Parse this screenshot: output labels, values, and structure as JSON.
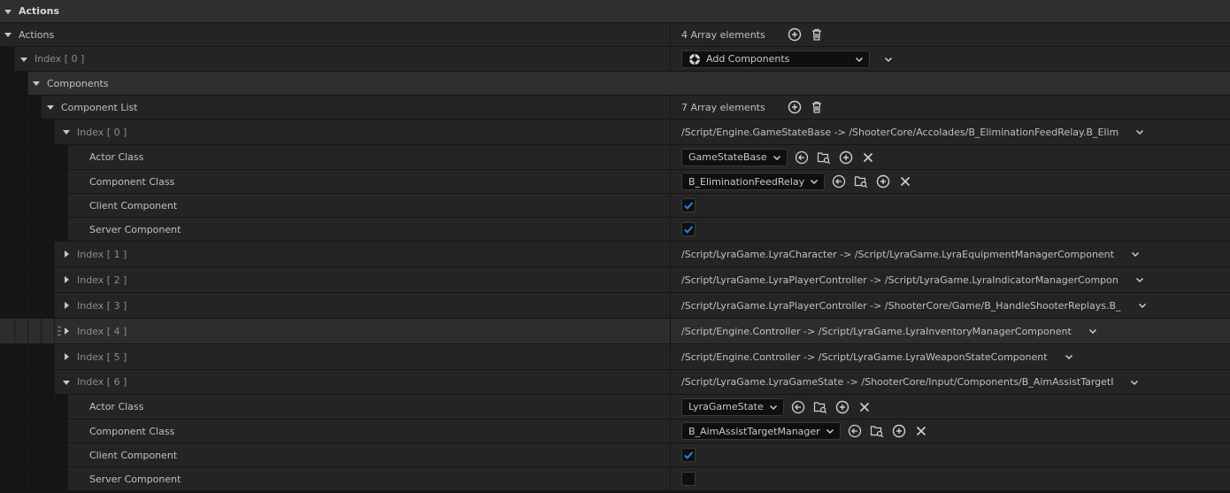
{
  "section": {
    "title": "Actions"
  },
  "rows": {
    "actions": {
      "label": "Actions",
      "value": "4 Array elements"
    },
    "index0": {
      "label": "Index [ 0 ]",
      "combo": "Add Components"
    },
    "components": {
      "label": "Components"
    },
    "component_list": {
      "label": "Component List",
      "value": "7 Array elements"
    },
    "item0": {
      "label": "Index [ 0 ]",
      "value": "/Script/Engine.GameStateBase -> /ShooterCore/Accolades/B_EliminationFeedRelay.B_Elim",
      "actor_class": {
        "label": "Actor Class",
        "value": "GameStateBase"
      },
      "component_class": {
        "label": "Component Class",
        "value": "B_EliminationFeedRelay"
      },
      "client_component": {
        "label": "Client Component",
        "checked": true
      },
      "server_component": {
        "label": "Server Component",
        "checked": true
      }
    },
    "item1": {
      "label": "Index [ 1 ]",
      "value": "/Script/LyraGame.LyraCharacter -> /Script/LyraGame.LyraEquipmentManagerComponent"
    },
    "item2": {
      "label": "Index [ 2 ]",
      "value": "/Script/LyraGame.LyraPlayerController -> /Script/LyraGame.LyraIndicatorManagerCompon"
    },
    "item3": {
      "label": "Index [ 3 ]",
      "value": "/Script/LyraGame.LyraPlayerController -> /ShooterCore/Game/B_HandleShooterReplays.B_"
    },
    "item4": {
      "label": "Index [ 4 ]",
      "value": "/Script/Engine.Controller -> /Script/LyraGame.LyraInventoryManagerComponent"
    },
    "item5": {
      "label": "Index [ 5 ]",
      "value": "/Script/Engine.Controller -> /Script/LyraGame.LyraWeaponStateComponent"
    },
    "item6": {
      "label": "Index [ 6 ]",
      "value": "/Script/LyraGame.LyraGameState -> /ShooterCore/Input/Components/B_AimAssistTargetI",
      "actor_class": {
        "label": "Actor Class",
        "value": "LyraGameState"
      },
      "component_class": {
        "label": "Component Class",
        "value": "B_AimAssistTargetManager"
      },
      "client_component": {
        "label": "Client Component",
        "checked": true
      },
      "server_component": {
        "label": "Server Component",
        "checked": false
      }
    }
  },
  "colors": {
    "check": "#2d7fe0",
    "background": "#151515",
    "row": "#242424",
    "category": "#2f2f2f"
  },
  "icons": [
    "triangle-down-icon",
    "triangle-right-icon",
    "add-circle-icon",
    "trash-icon",
    "chevron-down-icon",
    "use-selected-icon",
    "browse-icon",
    "clear-icon",
    "blueprint-icon",
    "check-icon"
  ]
}
